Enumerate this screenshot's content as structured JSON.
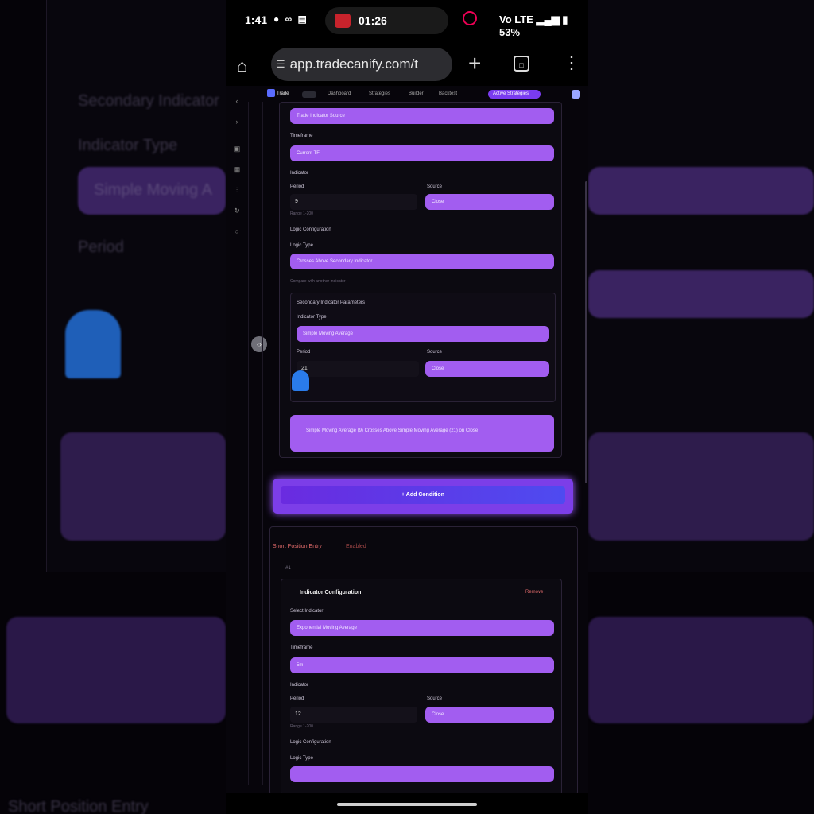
{
  "background": {
    "texts": [
      {
        "name": "bg-secondary-indicator",
        "text": "Secondary Indicator"
      },
      {
        "name": "bg-indicator-type",
        "text": "Indicator Type"
      },
      {
        "name": "bg-select",
        "text": "Simple Moving A"
      },
      {
        "name": "bg-period",
        "text": "Period"
      },
      {
        "name": "bg-short-entry",
        "text": "Short Position Entry"
      }
    ]
  },
  "status_bar": {
    "time": "1:41",
    "icons": "● ∞ ▤",
    "recording_time": "01:26",
    "right": "Vo LTE ▂▄▆ ▮ 53%"
  },
  "browser": {
    "url": "app.tradecanify.com/t"
  },
  "app_nav": {
    "brand": "Trade",
    "items": [
      "Dashboard",
      "Strategies",
      "Builder",
      "Backtest",
      "Active Strategies"
    ]
  },
  "form": {
    "field_source_label": "Trade Indicator Source",
    "label_timeframe": "Timeframe",
    "timeframe_value": "Current TF",
    "label_indicator": "Indicator",
    "label_period": "Period",
    "period_value": "9",
    "period_hint": "Range 1-200",
    "label_source": "Source",
    "source_value": "Close",
    "label_logic": "Logic Configuration",
    "label_logic_type": "Logic Type",
    "logic_type_value": "Crosses Above Secondary Indicator",
    "logic_note": "Compare with another indicator",
    "secondary_title": "Secondary Indicator Parameters",
    "label_indicator_type": "Indicator Type",
    "indicator_type_value": "Simple Moving Average",
    "label_period2": "Period",
    "period2_value": "21",
    "label_source2": "Source",
    "source2_value": "Close",
    "summary": "Simple Moving Average (9) Crosses Above Simple Moving Average (21) on Close",
    "add_button": "+ Add Condition",
    "short_title": "Short Position Entry",
    "short_tag": "Enabled",
    "sub_header": "#1",
    "indicator_config_title": "Indicator Configuration",
    "remove_label": "Remove",
    "label_select_indicator": "Select Indicator",
    "select_indicator_value": "Exponential Moving Average",
    "label_timeframe2": "Timeframe",
    "timeframe2_value": "5m",
    "label_indicator2": "Indicator",
    "label_period3": "Period",
    "period3_value": "12",
    "period3_hint": "Range 1-200",
    "label_source3": "Source",
    "source3_value": "Close",
    "label_logic2": "Logic Configuration",
    "label_logic_type2": "Logic Type"
  },
  "colors": {
    "accent": "#a25df0",
    "button": "#6a2be0",
    "danger": "#e06a6a"
  }
}
